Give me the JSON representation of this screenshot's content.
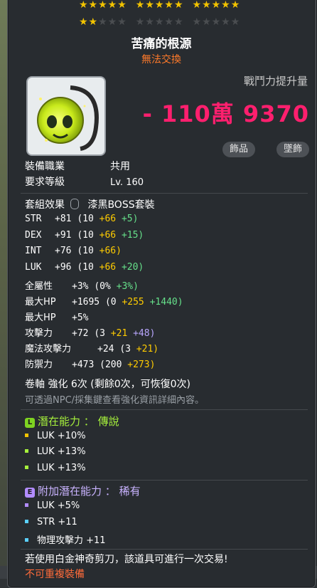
{
  "stars": {
    "rating_text": "★★",
    "total_slots": 25,
    "filled": 17
  },
  "item": {
    "name": "苦痛的根源",
    "trade_status": "無法交換",
    "power_label": "戰鬥力提升量",
    "power_value": "- 110萬 9370",
    "tags": [
      "飾品",
      "墜飾"
    ]
  },
  "requirements": {
    "job_label": "裝備職業",
    "job_value": "共用",
    "level_label": "要求等級",
    "level_value": "Lv. 160"
  },
  "set_effect": {
    "label": "套組效果",
    "value": "漆黑BOSS套裝"
  },
  "stats": [
    {
      "name": "STR",
      "total": "+81",
      "base": "(10",
      "add1": "+66",
      "add2": "+5)"
    },
    {
      "name": "DEX",
      "total": "+91",
      "base": "(10",
      "add1": "+66",
      "add2": "+15)"
    },
    {
      "name": "INT",
      "total": "+76",
      "base": "(10",
      "add1": "+66)",
      "add2": ""
    },
    {
      "name": "LUK",
      "total": "+96",
      "base": "(10",
      "add1": "+66",
      "add2": "+20)"
    },
    {
      "name": "全屬性",
      "total": "+3%",
      "base": "(0%",
      "add1": "",
      "add2": "+3%)"
    },
    {
      "name": "最大HP",
      "total": "+1695",
      "base": "(0",
      "add1": "+255",
      "add2": "+1440)"
    },
    {
      "name": "最大HP",
      "total": "+5%",
      "base": "",
      "add1": "",
      "add2": ""
    },
    {
      "name": "攻擊力",
      "total": "+72",
      "base": "(3",
      "add1": "+21",
      "add2": "+48)"
    },
    {
      "name": "魔法攻擊力",
      "total": "+24",
      "base": "(3",
      "add1": "+21)",
      "add2": ""
    },
    {
      "name": "防禦力",
      "total": "+473",
      "base": "(200",
      "add1": "+273)",
      "add2": ""
    }
  ],
  "enhance": {
    "line": "卷軸 強化 6次 (剩餘0次，可恢復0次)",
    "hint": "可透過NPC/採集鍵查看強化資訊詳細內容。"
  },
  "potential": {
    "badge": "L",
    "label": "潛在能力",
    "sep": "：",
    "grade": "傳說",
    "lines": [
      "LUK +10%",
      "LUK +13%",
      "LUK +13%"
    ]
  },
  "additional": {
    "badge": "E",
    "label": "附加潛在能力",
    "sep": "：",
    "grade": "稀有",
    "lines": [
      "LUK +5%",
      "STR +11",
      "物理攻擊力 +11"
    ]
  },
  "footer": {
    "scissors": "若使用白金神奇剪刀，該道具可進行一次交易!",
    "warning": "不可重複裝備"
  },
  "colors": {
    "power": "#ff1f6e",
    "legend_potential": "#7ed321",
    "epic_additional": "#b28cff",
    "star_gold": "#f2c300"
  }
}
